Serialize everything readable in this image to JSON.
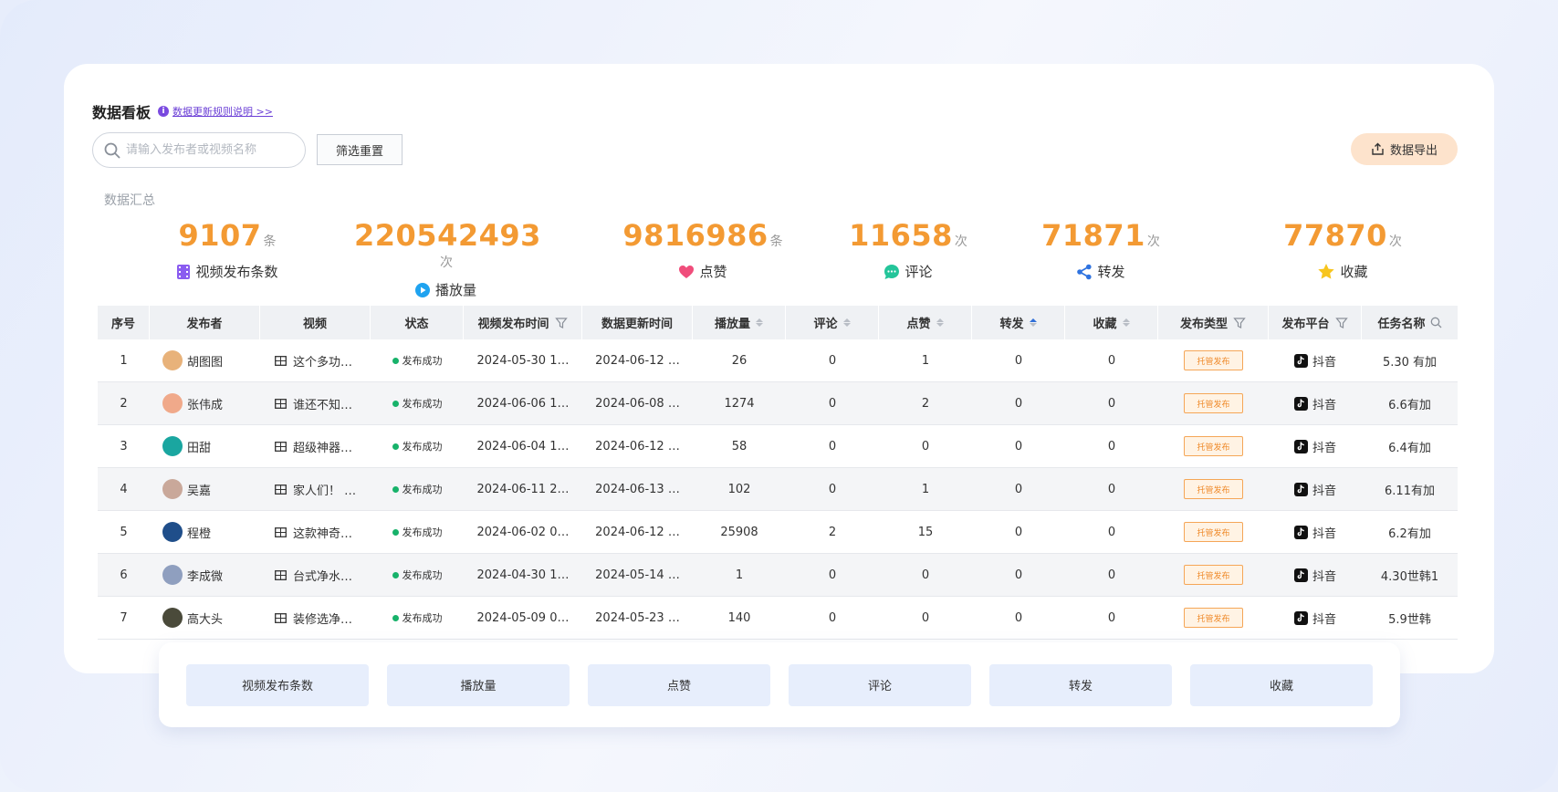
{
  "header": {
    "title": "数据看板",
    "rule_link": "数据更新规则说明 >>"
  },
  "search": {
    "placeholder": "请输入发布者或视频名称"
  },
  "buttons": {
    "reset": "筛选重置",
    "export": "数据导出"
  },
  "summary": {
    "title": "数据汇总",
    "stats": [
      {
        "value": "9107",
        "unit": "条",
        "label": "视频发布条数",
        "icon": "film-icon",
        "color": "#8a5cf0"
      },
      {
        "value": "220542493",
        "unit": "次",
        "label": "播放量",
        "icon": "play-icon",
        "color": "#1fa3f0"
      },
      {
        "value": "9816986",
        "unit": "条",
        "label": "点赞",
        "icon": "heart-icon",
        "color": "#f04d7b"
      },
      {
        "value": "11658",
        "unit": "次",
        "label": "评论",
        "icon": "comment-icon",
        "color": "#24c59a"
      },
      {
        "value": "71871",
        "unit": "次",
        "label": "转发",
        "icon": "share-icon",
        "color": "#2f73e0"
      },
      {
        "value": "77870",
        "unit": "次",
        "label": "收藏",
        "icon": "star-icon",
        "color": "#f7c51e"
      }
    ]
  },
  "table": {
    "columns": [
      "序号",
      "发布者",
      "视频",
      "状态",
      "视频发布时间",
      "数据更新时间",
      "播放量",
      "评论",
      "点赞",
      "转发",
      "收藏",
      "发布类型",
      "发布平台",
      "任务名称"
    ],
    "rows": [
      {
        "no": "1",
        "publisher": "胡图图",
        "video": "这个多功…",
        "status": "发布成功",
        "publish_time": "2024-05-30 1…",
        "update_time": "2024-06-12 …",
        "plays": "26",
        "comments": "0",
        "likes": "1",
        "shares": "0",
        "favs": "0",
        "type": "托管发布",
        "platform": "抖音",
        "task": "5.30 有加"
      },
      {
        "no": "2",
        "publisher": "张伟成",
        "video": "谁还不知…",
        "status": "发布成功",
        "publish_time": "2024-06-06 1…",
        "update_time": "2024-06-08 …",
        "plays": "1274",
        "comments": "0",
        "likes": "2",
        "shares": "0",
        "favs": "0",
        "type": "托管发布",
        "platform": "抖音",
        "task": "6.6有加"
      },
      {
        "no": "3",
        "publisher": "田甜",
        "video": "超级神器…",
        "status": "发布成功",
        "publish_time": "2024-06-04 1…",
        "update_time": "2024-06-12 …",
        "plays": "58",
        "comments": "0",
        "likes": "0",
        "shares": "0",
        "favs": "0",
        "type": "托管发布",
        "platform": "抖音",
        "task": "6.4有加"
      },
      {
        "no": "4",
        "publisher": "吴嘉",
        "video": "家人们！ …",
        "status": "发布成功",
        "publish_time": "2024-06-11 2…",
        "update_time": "2024-06-13 …",
        "plays": "102",
        "comments": "0",
        "likes": "1",
        "shares": "0",
        "favs": "0",
        "type": "托管发布",
        "platform": "抖音",
        "task": "6.11有加"
      },
      {
        "no": "5",
        "publisher": "程橙",
        "video": "这款神奇…",
        "status": "发布成功",
        "publish_time": "2024-06-02 0…",
        "update_time": "2024-06-12 …",
        "plays": "25908",
        "comments": "2",
        "likes": "15",
        "shares": "0",
        "favs": "0",
        "type": "托管发布",
        "platform": "抖音",
        "task": "6.2有加"
      },
      {
        "no": "6",
        "publisher": "李成微",
        "video": "台式净水…",
        "status": "发布成功",
        "publish_time": "2024-04-30 1…",
        "update_time": "2024-05-14 …",
        "plays": "1",
        "comments": "0",
        "likes": "0",
        "shares": "0",
        "favs": "0",
        "type": "托管发布",
        "platform": "抖音",
        "task": "4.30世韩1"
      },
      {
        "no": "7",
        "publisher": "高大头",
        "video": "装修选净…",
        "status": "发布成功",
        "publish_time": "2024-05-09 0…",
        "update_time": "2024-05-23 …",
        "plays": "140",
        "comments": "0",
        "likes": "0",
        "shares": "0",
        "favs": "0",
        "type": "托管发布",
        "platform": "抖音",
        "task": "5.9世韩"
      }
    ]
  },
  "metric_tabs": [
    "视频发布条数",
    "播放量",
    "点赞",
    "评论",
    "转发",
    "收藏"
  ]
}
